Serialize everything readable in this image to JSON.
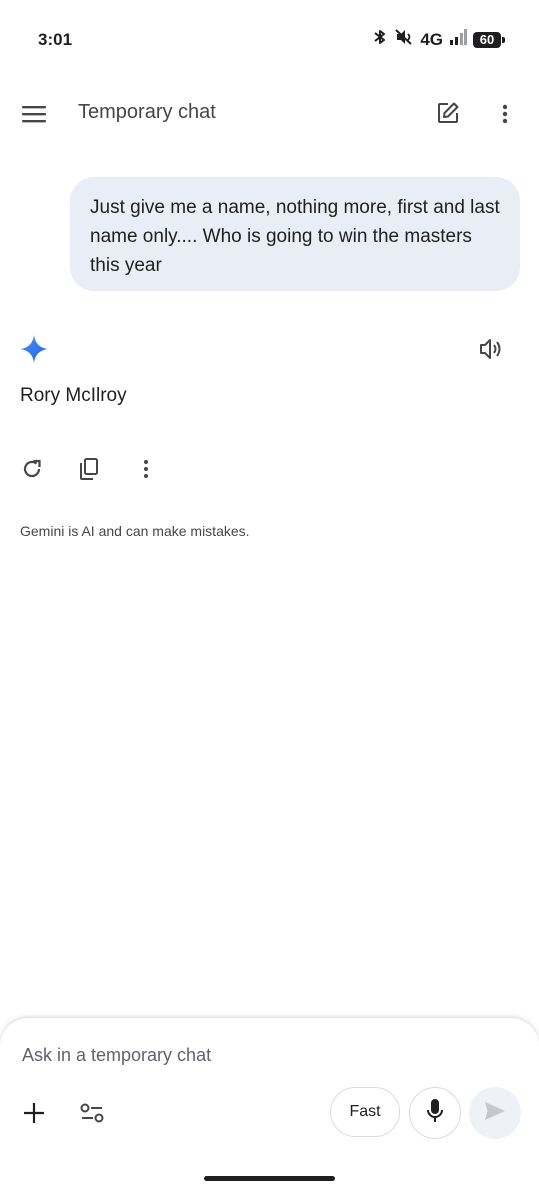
{
  "status_bar": {
    "time": "3:01",
    "network": "4G",
    "battery": "60",
    "icons": [
      "bluetooth-icon",
      "mute-icon",
      "signal-icon",
      "battery-icon"
    ]
  },
  "header": {
    "title": "Temporary chat",
    "icons": [
      "menu-icon",
      "new-chat-icon",
      "more-vert-icon"
    ]
  },
  "conversation": {
    "user_message": "Just give me a name, nothing more, first and last name only.... Who is going to win the masters this year",
    "model_response": "Rory McIlroy",
    "response_icons": [
      "gemini-sparkle-icon",
      "speaker-icon"
    ],
    "action_icons": [
      "refresh-icon",
      "copy-icon",
      "more-vert-icon"
    ],
    "disclaimer": "Gemini is AI and can make mistakes."
  },
  "input": {
    "placeholder": "Ask in a temporary chat",
    "mode_chip": "Fast",
    "icons": [
      "plus-icon",
      "tools-icon",
      "mic-icon",
      "send-icon"
    ]
  },
  "colors": {
    "bubble": "#e9eef6",
    "gemini_accent": "#4285f4",
    "text": "#1f1f1f",
    "secondary_text": "#444746"
  }
}
